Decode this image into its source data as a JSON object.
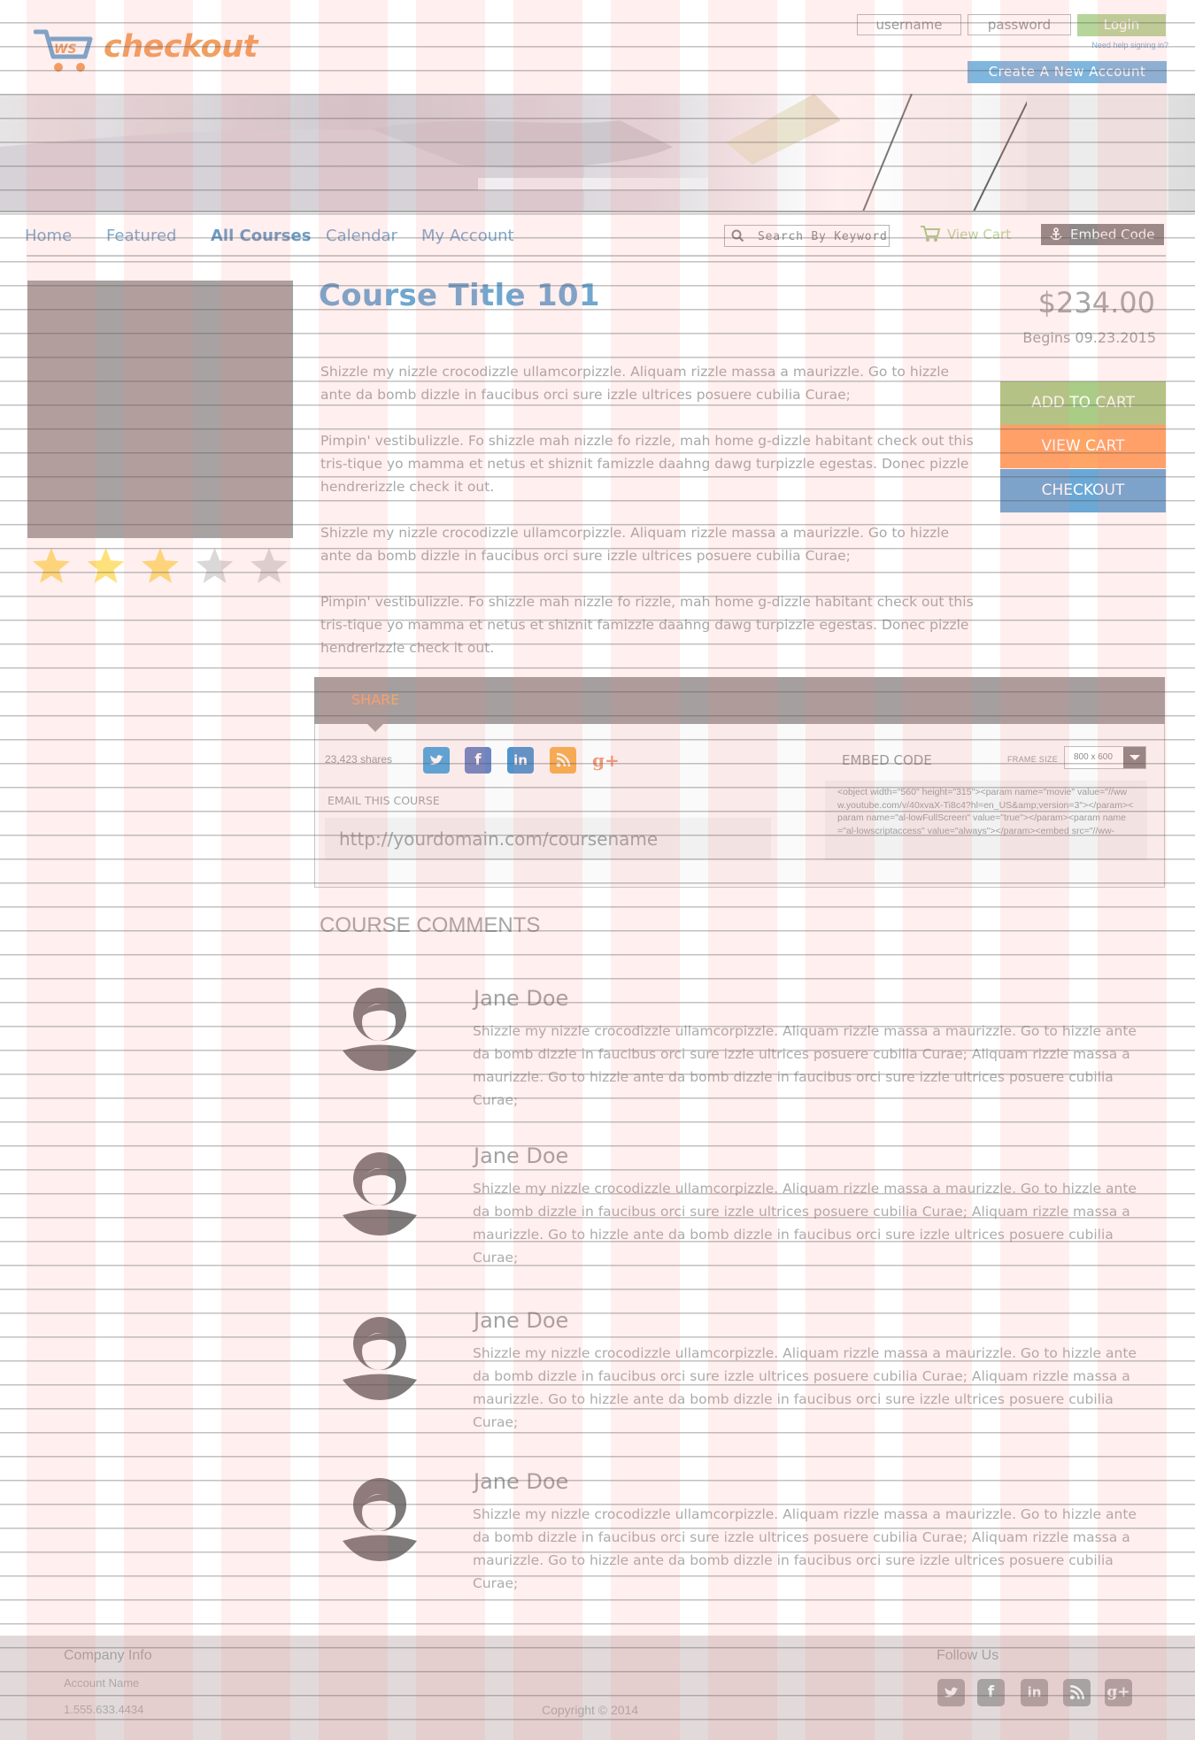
{
  "header": {
    "logo_text": "checkout",
    "logo_mark": "WS",
    "username_placeholder": "username",
    "password_placeholder": "password",
    "login_label": "Login",
    "help_link": "Need help signing in?",
    "create_account_label": "Create  A  New  Account"
  },
  "nav": {
    "items": [
      {
        "label": "Home"
      },
      {
        "label": "Featured"
      },
      {
        "label": "All Courses"
      },
      {
        "label": "Calendar"
      },
      {
        "label": "My Account"
      }
    ],
    "search_placeholder": "Search By Keyword",
    "view_cart_label": "View Cart",
    "embed_code_label": "Embed Code"
  },
  "course": {
    "title": "Course Title 101",
    "price": "$234.00",
    "begins": "Begins 09.23.2015",
    "rating": 3,
    "rating_max": 5,
    "paragraphs": [
      "Shizzle my nizzle crocodizzle ullamcorpizzle. Aliquam rizzle massa a maurizzle. Go to hizzle ante da bomb dizzle in faucibus orci sure izzle ultrices posuere cubilia Curae;",
      "Pimpin' vestibulizzle. Fo shizzle mah nizzle fo rizzle, mah home g-dizzle habitant check out this tris-tique yo mamma et netus et shiznit famizzle daahng dawg turpizzle egestas. Donec pizzle hendrerizzle check it out.",
      "Shizzle my nizzle crocodizzle ullamcorpizzle. Aliquam rizzle massa a maurizzle. Go to hizzle ante da bomb dizzle in faucibus orci sure izzle ultrices posuere cubilia Curae;",
      "Pimpin' vestibulizzle. Fo shizzle mah nizzle fo rizzle, mah home g-dizzle habitant check out this tris-tique yo mamma et netus et shiznit famizzle daahng dawg turpizzle egestas. Donec pizzle hendrerizzle check it out."
    ],
    "add_to_cart_label": "ADD TO CART",
    "view_cart_label": "VIEW CART",
    "checkout_label": "CHECKOUT"
  },
  "share": {
    "tab_label": "SHARE",
    "shares_count": "23,423 shares",
    "embed_label": "EMBED CODE",
    "frame_size_label": "FRAME SIZE",
    "frame_size_value": "800 x 600",
    "email_label": "EMAIL THIS COURSE",
    "course_url": "http://yourdomain.com/coursename",
    "embed_snippet": "<object width=\"560\" height=\"315\"><param name=\"movie\" value=\"//www.youtube.com/v/40xvaX-Ti8c4?hl=en_US&amp;version=3\"></param><param name=\"al-lowFullScreen\" value=\"true\"></param><param name=\"al-lowscriptaccess\" value=\"always\"></param><embed src=\"//ww-",
    "social_icons": [
      "twitter-icon",
      "facebook-icon",
      "linkedin-icon",
      "rss-icon",
      "google-plus-icon"
    ]
  },
  "comments": {
    "title": "COURSE COMMENTS",
    "items": [
      {
        "name": "Jane Doe",
        "text": "Shizzle my nizzle crocodizzle ullamcorpizzle. Aliquam rizzle massa a maurizzle. Go to hizzle ante da bomb dizzle in faucibus orci sure izzle ultrices posuere cubilia Curae;   Aliquam rizzle massa a maurizzle. Go to hizzle ante da bomb dizzle in faucibus orci sure izzle ultrices posuere cubilia Curae;"
      },
      {
        "name": "Jane Doe",
        "text": "Shizzle my nizzle crocodizzle ullamcorpizzle. Aliquam rizzle massa a maurizzle. Go to hizzle ante da bomb dizzle in faucibus orci sure izzle ultrices posuere cubilia Curae;   Aliquam rizzle massa a maurizzle. Go to hizzle ante da bomb dizzle in faucibus orci sure izzle ultrices posuere cubilia Curae;"
      },
      {
        "name": "Jane Doe",
        "text": "Shizzle my nizzle crocodizzle ullamcorpizzle. Aliquam rizzle massa a maurizzle. Go to hizzle ante da bomb dizzle in faucibus orci sure izzle ultrices posuere cubilia Curae;   Aliquam rizzle massa a maurizzle. Go to hizzle ante da bomb dizzle in faucibus orci sure izzle ultrices posuere cubilia Curae;"
      },
      {
        "name": "Jane Doe",
        "text": "Shizzle my nizzle crocodizzle ullamcorpizzle. Aliquam rizzle massa a maurizzle. Go to hizzle ante da bomb dizzle in faucibus orci sure izzle ultrices posuere cubilia Curae;   Aliquam rizzle massa a maurizzle. Go to hizzle ante da bomb dizzle in faucibus orci sure izzle ultrices posuere cubilia Curae;"
      }
    ]
  },
  "footer": {
    "company_heading": "Company Info",
    "account_name": "Account Name",
    "phone": "1.555.633.4434",
    "copyright": "Copyright © 2014",
    "follow_heading": "Follow Us"
  },
  "colors": {
    "brand_orange": "#f0a060",
    "link_blue": "#7fa8c9",
    "title_blue": "#6fa7cf",
    "green": "#a9cd86",
    "orange": "#ffa565",
    "blue": "#6ba8d6",
    "gray": "#a59f9f"
  }
}
